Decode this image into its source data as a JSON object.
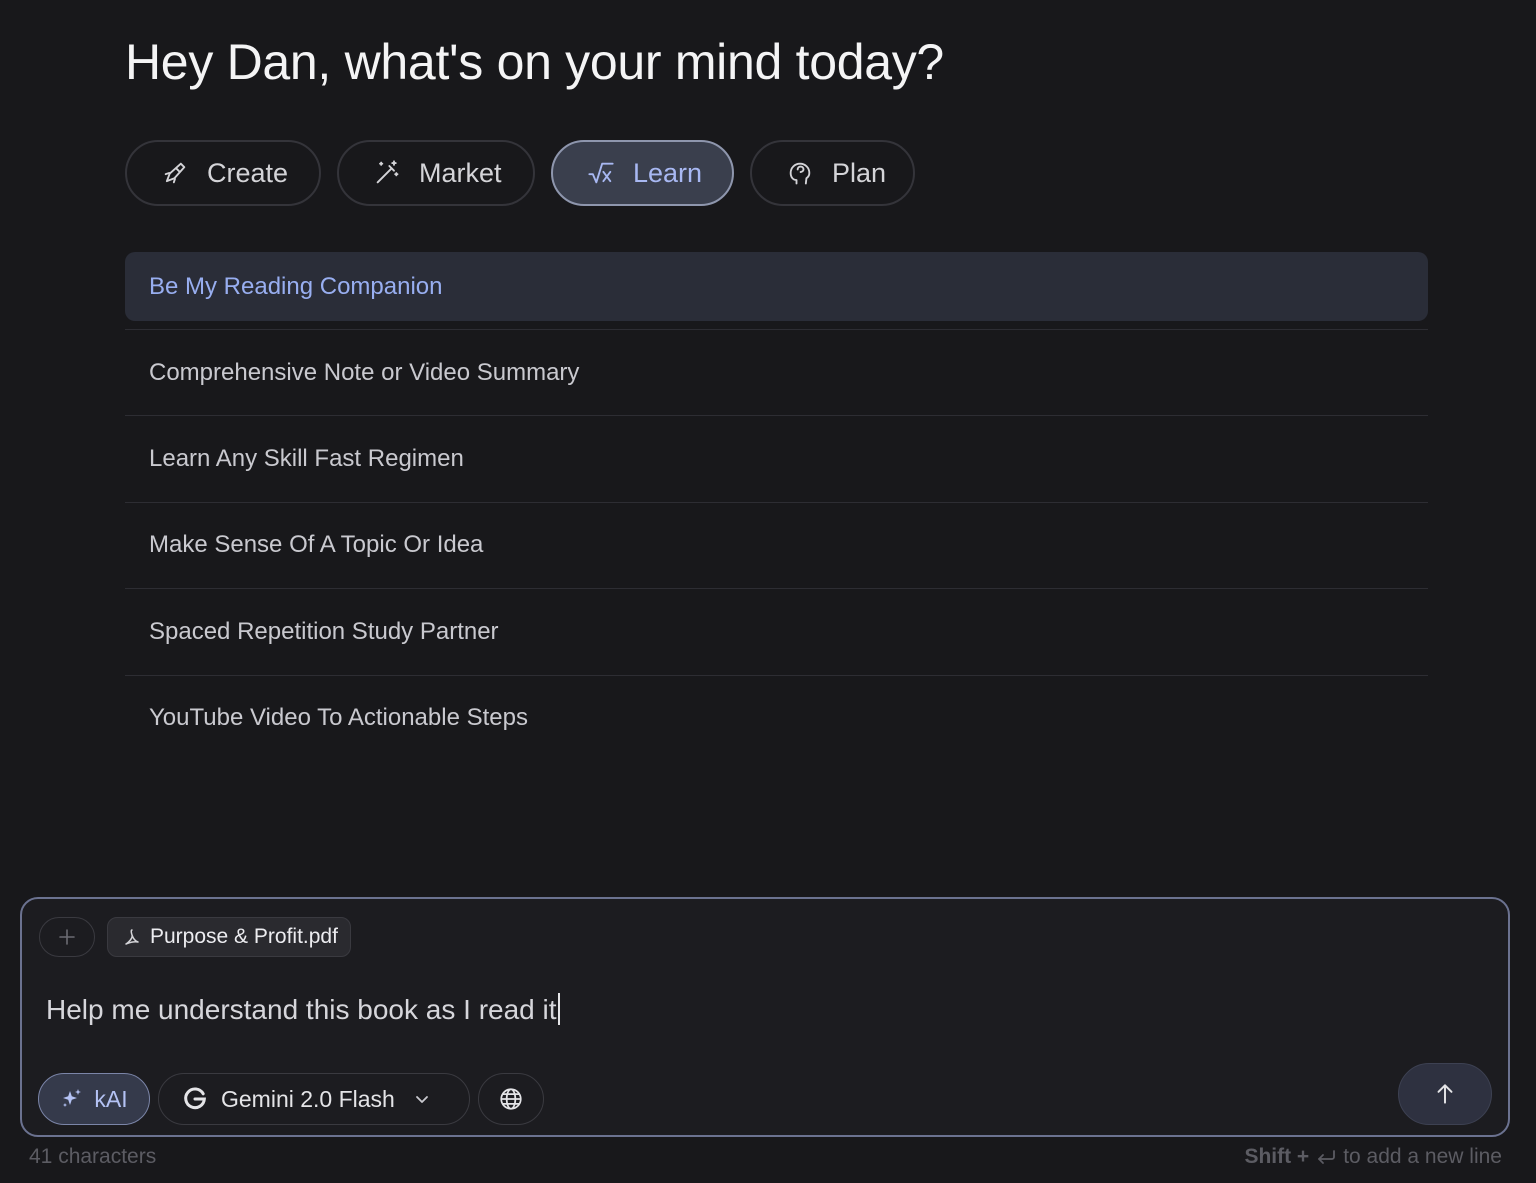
{
  "greeting": "Hey Dan, what's on your mind today?",
  "tabs": [
    {
      "label": "Create",
      "icon": "rocket-icon",
      "active": false
    },
    {
      "label": "Market",
      "icon": "magic-wand-icon",
      "active": false
    },
    {
      "label": "Learn",
      "icon": "square-root-icon",
      "active": true
    },
    {
      "label": "Plan",
      "icon": "brain-icon",
      "active": false
    }
  ],
  "prompts": [
    {
      "label": "Be My Reading Companion",
      "selected": true
    },
    {
      "label": "Comprehensive Note or Video Summary",
      "selected": false
    },
    {
      "label": "Learn Any Skill Fast Regimen",
      "selected": false
    },
    {
      "label": "Make Sense Of A Topic Or Idea",
      "selected": false
    },
    {
      "label": "Spaced Repetition Study Partner",
      "selected": false
    },
    {
      "label": "YouTube Video To Actionable Steps",
      "selected": false
    }
  ],
  "composer": {
    "attachment": "Purpose & Profit.pdf",
    "input_text": "Help me understand this book as I read it",
    "kai_label": "kAI",
    "model_label": "Gemini 2.0 Flash"
  },
  "footer": {
    "char_count": "41 characters",
    "hint_key": "Shift +",
    "hint_text": "to add a new line"
  },
  "colors": {
    "background": "#18181b",
    "accent": "#a8b8f2",
    "active_tab_bg": "#3a3f4d",
    "composer_border": "#6b7290"
  }
}
